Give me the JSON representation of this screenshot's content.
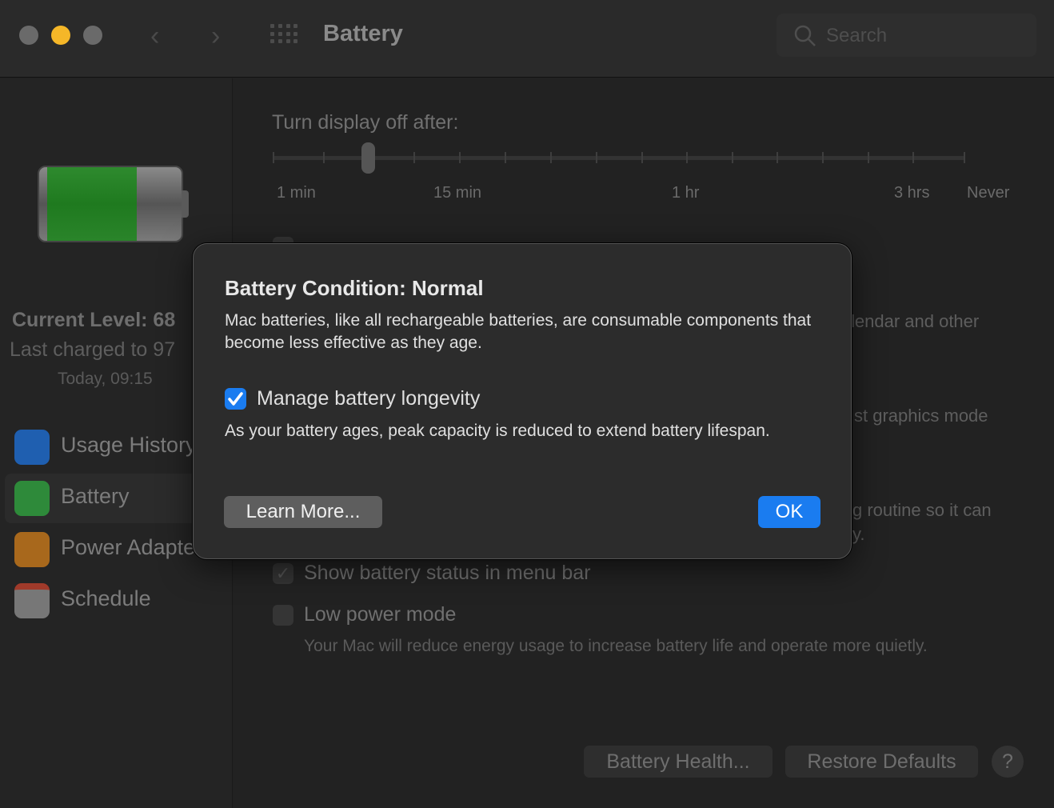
{
  "window": {
    "title": "Battery",
    "search_placeholder": "Search"
  },
  "colors": {
    "accent": "#1a7cf0",
    "battery_fill": "#1f7a1f",
    "traffic_minimize": "#f5b728"
  },
  "sidebar": {
    "current_level": "Current Level: 68",
    "last_charged": "Last charged to 97",
    "charged_time": "Today, 09:15",
    "battery_level_percent": 68,
    "items": [
      {
        "label": "Usage History",
        "icon": "bar-chart-icon"
      },
      {
        "label": "Battery",
        "icon": "battery-icon",
        "selected": true
      },
      {
        "label": "Power Adapter",
        "icon": "lightning-icon"
      },
      {
        "label": "Schedule",
        "icon": "calendar-icon"
      }
    ]
  },
  "main": {
    "display_off_label": "Turn display off after:",
    "slider_ticks": [
      "1 min",
      "15 min",
      "1 hr",
      "3 hrs",
      "Never"
    ],
    "slider_value": "3 min",
    "fragments": [
      "lendar and other",
      "st graphics mode",
      "g routine so it can",
      "y."
    ],
    "show_status": {
      "label": "Show battery status in menu bar",
      "checked": true
    },
    "low_power": {
      "label": "Low power mode",
      "checked": false,
      "description": "Your Mac will reduce energy usage to increase battery life and operate more quietly."
    },
    "battery_health_button": "Battery Health...",
    "restore_defaults_button": "Restore Defaults",
    "help_button": "?"
  },
  "dialog": {
    "title": "Battery Condition: Normal",
    "body": "Mac batteries, like all rechargeable batteries, are consumable components that become less effective as they age.",
    "checkbox": {
      "label": "Manage battery longevity",
      "checked": true
    },
    "checkbox_description": "As your battery ages, peak capacity is reduced to extend battery lifespan.",
    "learn_more": "Learn More...",
    "ok": "OK"
  }
}
